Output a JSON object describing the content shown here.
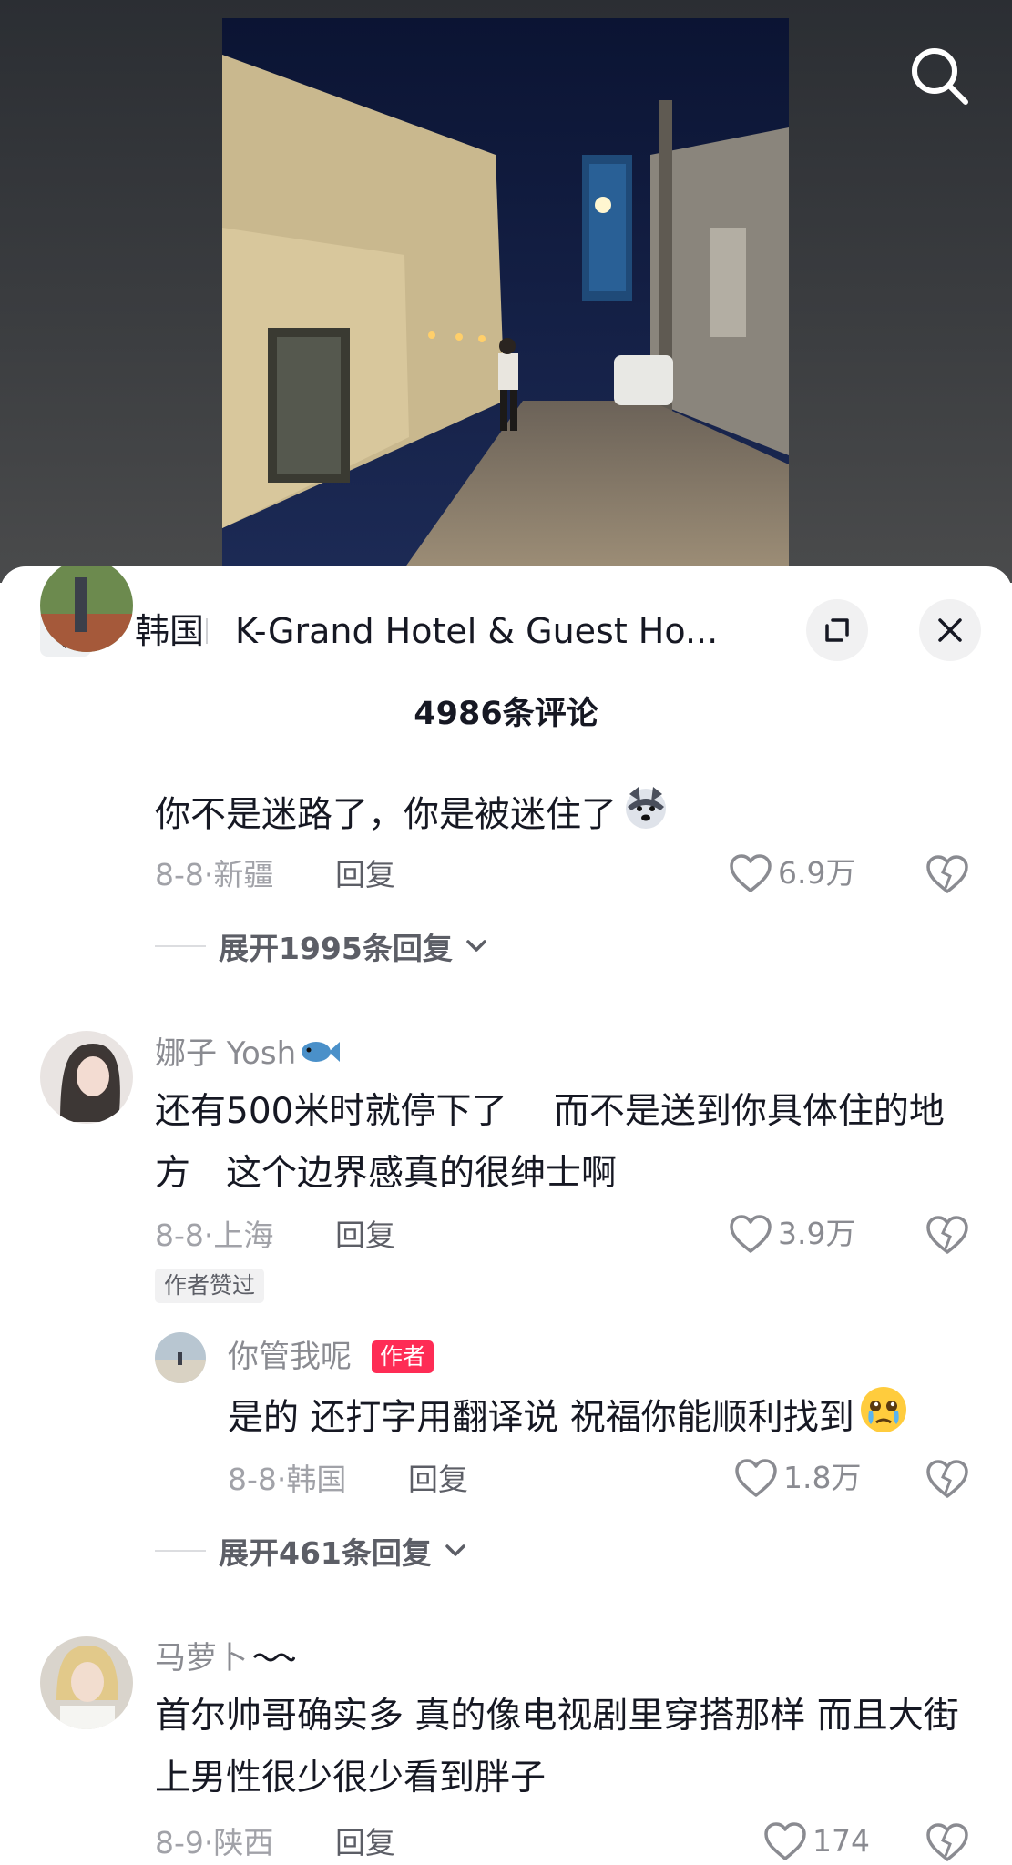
{
  "location": {
    "country": "韩国",
    "name": "K-Grand Hotel & Guest Ho..."
  },
  "comments_title": "4986条评论",
  "comments": [
    {
      "username": "",
      "text": "你不是迷路了，你是被迷住了",
      "date_region": "8-8·新疆",
      "reply_label": "回复",
      "likes": "6.9万",
      "expand_label": "展开1995条回复"
    },
    {
      "username": "娜子 Yosh",
      "text": "还有500米时就停下了　 而不是送到你具体住的地方　这个边界感真的很绅士啊",
      "date_region": "8-8·上海",
      "reply_label": "回复",
      "likes": "3.9万",
      "author_liked_badge": "作者赞过",
      "sub_reply": {
        "username": "你管我呢",
        "author_badge": "作者",
        "text": "是的 还打字用翻译说 祝福你能顺利找到",
        "date_region": "8-8·韩国",
        "reply_label": "回复",
        "likes": "1.8万"
      },
      "expand_label": "展开461条回复"
    },
    {
      "username": "马萝卜",
      "text": "首尔帅哥确实多 真的像电视剧里穿搭那样 而且大街上男性很少很少看到胖子",
      "date_region": "8-9·陕西",
      "reply_label": "回复",
      "likes": "174"
    }
  ],
  "colors": {
    "accent_red": "#fe2c55",
    "text_primary": "#161823",
    "text_secondary": "#8a8b91"
  }
}
